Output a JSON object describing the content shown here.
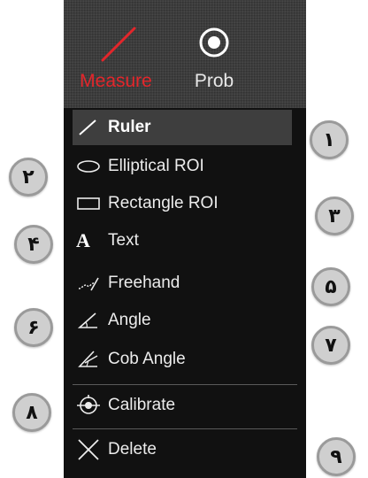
{
  "toolbar": {
    "measure_label": "Measure",
    "probe_label": "Prob",
    "measure_icon": "line-measure-icon",
    "probe_icon": "target-icon",
    "active_color": "#e3262b"
  },
  "menu": {
    "items": [
      {
        "label": "Ruler",
        "icon": "ruler-line-icon",
        "active": true
      },
      {
        "label": "Elliptical ROI",
        "icon": "ellipse-icon"
      },
      {
        "label": "Rectangle ROI",
        "icon": "rectangle-icon"
      },
      {
        "label": "Text",
        "icon": "text-a-icon"
      },
      {
        "label": "Freehand",
        "icon": "freehand-icon"
      },
      {
        "label": "Angle",
        "icon": "angle-icon"
      },
      {
        "label": "Cob Angle",
        "icon": "cob-angle-icon"
      },
      {
        "label": "Calibrate",
        "icon": "calibrate-icon"
      },
      {
        "label": "Delete",
        "icon": "delete-x-icon"
      }
    ]
  },
  "callouts": [
    "١",
    "٢",
    "٣",
    "۴",
    "۵",
    "۶",
    "٧",
    "٨",
    "٩"
  ]
}
